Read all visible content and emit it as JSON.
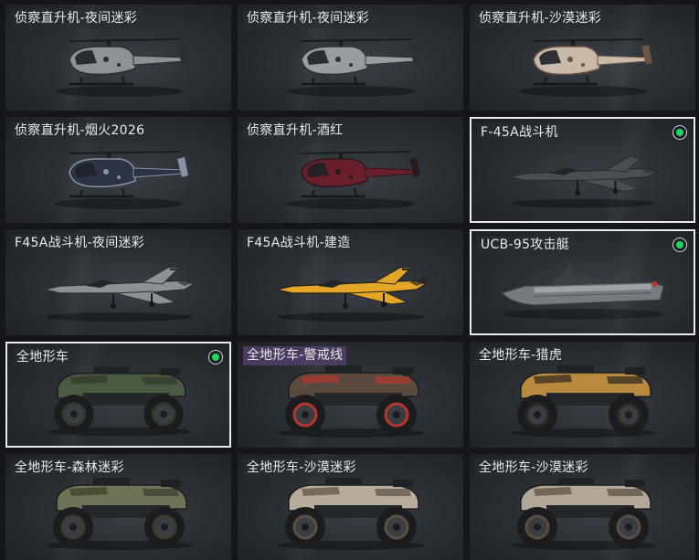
{
  "items": [
    {
      "label": "侦察直升机-夜间迷彩",
      "kind": "helicopter",
      "body": "#8e9296",
      "accent": "#2b2e31",
      "selected": false
    },
    {
      "label": "侦察直升机-夜间迷彩",
      "kind": "helicopter",
      "body": "#9a9d9f",
      "accent": "#2e3134",
      "selected": false
    },
    {
      "label": "侦察直升机-沙漠迷彩",
      "kind": "helicopter",
      "body": "#c9b9a8",
      "accent": "#6b5446",
      "selected": false
    },
    {
      "label": "侦察直升机-烟火2026",
      "kind": "helicopter",
      "body": "#2b3345",
      "accent": "#8a90a6",
      "selected": false
    },
    {
      "label": "侦察直升机-酒红",
      "kind": "helicopter",
      "body": "#6b1f2c",
      "accent": "#2a1a1e",
      "selected": false
    },
    {
      "label": "F-45A战斗机",
      "kind": "jet",
      "body": "#4a4e52",
      "accent": "#2a2d30",
      "selected": true
    },
    {
      "label": "F45A战斗机-夜间迷彩",
      "kind": "jet",
      "body": "#8d9196",
      "accent": "#2c2f33",
      "selected": false
    },
    {
      "label": "F45A战斗机-建造",
      "kind": "jet",
      "body": "#e3a626",
      "accent": "#242424",
      "selected": false
    },
    {
      "label": "UCB-95攻击艇",
      "kind": "boat",
      "body": "#777b80",
      "accent": "#3b3f43",
      "selected": true
    },
    {
      "label": "全地形车",
      "kind": "atv",
      "body": "#4b5940",
      "accent": "#2f3a2a",
      "selected": true
    },
    {
      "label": "全地形车-警戒线",
      "kind": "atv",
      "body": "#5a4a3e",
      "accent": "#b4362e",
      "selected": false,
      "label_style": "purple"
    },
    {
      "label": "全地形车-猎虎",
      "kind": "atv",
      "body": "#b98a3e",
      "accent": "#2b2620",
      "selected": false
    },
    {
      "label": "全地形车-森林迷彩",
      "kind": "atv",
      "body": "#6f7356",
      "accent": "#3a3e2c",
      "selected": false
    },
    {
      "label": "全地形车-沙漠迷彩",
      "kind": "atv",
      "body": "#b8ad9c",
      "accent": "#5d4f41",
      "selected": false
    },
    {
      "label": "全地形车-沙漠迷彩",
      "kind": "atv",
      "body": "#b3a898",
      "accent": "#5a4c3f",
      "selected": false
    }
  ]
}
